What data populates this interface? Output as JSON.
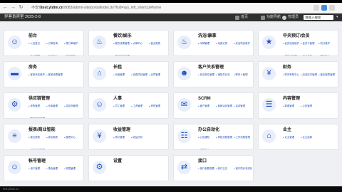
{
  "browser": {
    "secure_label": "不安全",
    "url_host": "test.ytdim.cn",
    "url_path": ":8083/admin-site/portal/index.do?fsid=sys_left_shortcut#home"
  },
  "appbar": {
    "title": "异客贵宾室 2025-2-8",
    "home_label": "首页",
    "function_label": "功能导航",
    "user_label": "管理员",
    "search_value": "请输入搜索"
  },
  "modules": [
    {
      "title": "前台",
      "icon": "reception-icon",
      "links": [
        "入住登记",
        "订单查询",
        "预订单维护",
        "开台提醒",
        "包房开台",
        "客户服务"
      ]
    },
    {
      "title": "餐饮/娱乐",
      "icon": "dining-icon",
      "links": [
        "餐饮设置管理",
        "点单中心",
        "营业报表",
        "菜品库存管理"
      ]
    },
    {
      "title": "洗浴/康拿",
      "icon": "bath-icon",
      "links": [
        "手牌管理",
        "消费记录",
        "洗浴项目维护"
      ]
    },
    {
      "title": "中央预订/会员",
      "icon": "membership-icon",
      "links": [
        "会员信息维护",
        "会员卡管理",
        "积分维护",
        "储值卡管理",
        "积分兑换",
        "预订中心"
      ]
    },
    {
      "title": "房务",
      "icon": "bed-icon",
      "links": [
        "客房状态维护",
        "客房设置管理"
      ]
    },
    {
      "title": "长租",
      "icon": "lease-icon",
      "links": [
        "长租管理",
        "收费项目管理",
        "合同管理"
      ]
    },
    {
      "title": "客户关系管理",
      "icon": "crm-icon",
      "links": [
        "协议单位管理",
        "销售员业务",
        "联系人管理"
      ]
    },
    {
      "title": "财务",
      "icon": "finance-icon",
      "links": [
        "财务审核中心",
        "应收应付管理",
        "营业报表管理"
      ]
    },
    {
      "title": "供应链管理",
      "icon": "supply-icon",
      "links": [
        "采购管理",
        "仓库管理",
        "供应商管理",
        "物品档案管理"
      ]
    },
    {
      "title": "人事",
      "icon": "hr-icon",
      "links": [
        "员工管理",
        "工资管理",
        "考勤管理"
      ]
    },
    {
      "title": "SCRM",
      "icon": "scrm-icon",
      "links": [
        "客户管理",
        "营销活动管理",
        "活动管理"
      ]
    },
    {
      "title": "内容管理",
      "icon": "content-icon",
      "links": [
        "新闻管理",
        "公告管理"
      ]
    },
    {
      "title": "报表/商业智能",
      "icon": "report-icon",
      "links": [
        "营业报表",
        "综合报表",
        "图表中心",
        "经营分析报表"
      ]
    },
    {
      "title": "收益管理",
      "icon": "revenue-icon",
      "links": [
        "房价管理",
        "收益分析"
      ]
    },
    {
      "title": "办公自动化",
      "icon": "oa-icon",
      "links": [
        "公告通知",
        "审批流程管理",
        "工作流程管理",
        "文档中心"
      ]
    },
    {
      "title": "业主",
      "icon": "owner-icon",
      "links": [
        "业主管理",
        "业主结算"
      ]
    },
    {
      "title": "帐号管理",
      "icon": "account-icon",
      "links": [
        "用户管理",
        "角色管理",
        "权限管理"
      ]
    },
    {
      "title": "设置",
      "icon": "settings-icon",
      "links": []
    },
    {
      "title": "接口",
      "icon": "interface-icon",
      "links": [
        "接口参数配置",
        "接口日志",
        "接口同步状态管理"
      ]
    }
  ],
  "colors": {
    "accent": "#1f4fbf",
    "icon_bg": "#e9eefb",
    "appbar": "#2f2f2f"
  },
  "status_text": "test.ytdim.cn"
}
